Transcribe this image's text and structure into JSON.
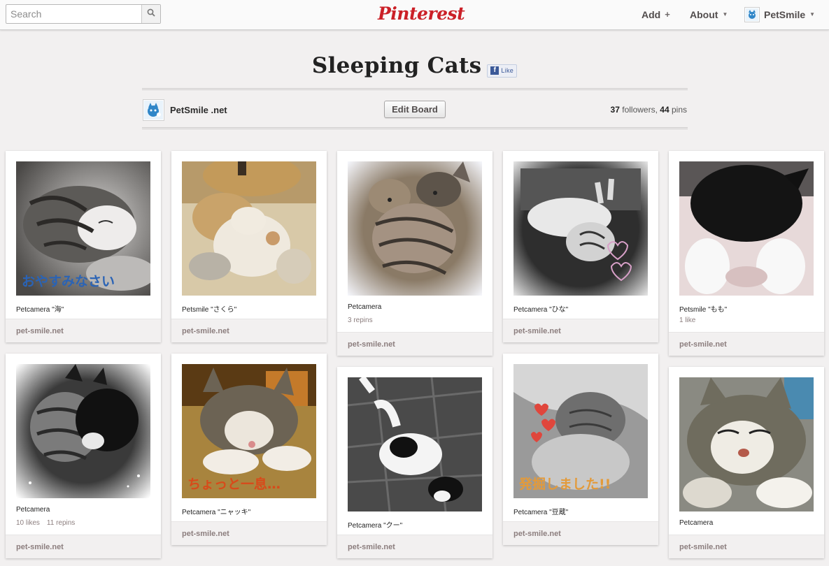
{
  "header": {
    "search_placeholder": "Search",
    "logo": "Pinterest",
    "nav": {
      "add": "Add",
      "about": "About",
      "user": "PetSmile"
    }
  },
  "board": {
    "title": "Sleeping Cats",
    "fb_like": "Like",
    "owner": "PetSmile .net",
    "edit_button": "Edit Board",
    "followers_count": "37",
    "followers_label": "followers,",
    "pins_count": "44",
    "pins_label": "pins"
  },
  "pins": [
    {
      "desc": "Petcamera \"海\"",
      "likes": "",
      "repins": "",
      "source": "pet-smile.net",
      "overlay": "おやすみなさい"
    },
    {
      "desc": "Petsmile \"さくら\"",
      "likes": "",
      "repins": "",
      "source": "pet-smile.net",
      "overlay": ""
    },
    {
      "desc": "Petcamera",
      "likes": "",
      "repins": "3 repins",
      "source": "pet-smile.net",
      "overlay": ""
    },
    {
      "desc": "Petcamera \"ひな\"",
      "likes": "",
      "repins": "",
      "source": "pet-smile.net",
      "overlay": ""
    },
    {
      "desc": "Petsmile \"もも\"",
      "likes": "1 like",
      "repins": "",
      "source": "pet-smile.net",
      "overlay": ""
    },
    {
      "desc": "Petcamera",
      "likes": "10 likes",
      "repins": "11 repins",
      "source": "pet-smile.net",
      "overlay": ""
    },
    {
      "desc": "Petcamera \"ニャッキ\"",
      "likes": "",
      "repins": "",
      "source": "pet-smile.net",
      "overlay": "ちょっと一息…"
    },
    {
      "desc": "Petcamera \"クー\"",
      "likes": "",
      "repins": "",
      "source": "pet-smile.net",
      "overlay": ""
    },
    {
      "desc": "Petcamera \"豆蔵\"",
      "likes": "",
      "repins": "",
      "source": "pet-smile.net",
      "overlay": "発掘しました!!"
    },
    {
      "desc": "Petcamera",
      "likes": "",
      "repins": "",
      "source": "pet-smile.net",
      "overlay": ""
    }
  ],
  "colors": {
    "brand": "#cb2027",
    "background": "#f2f0f0",
    "source_text": "#8c7e7e"
  }
}
